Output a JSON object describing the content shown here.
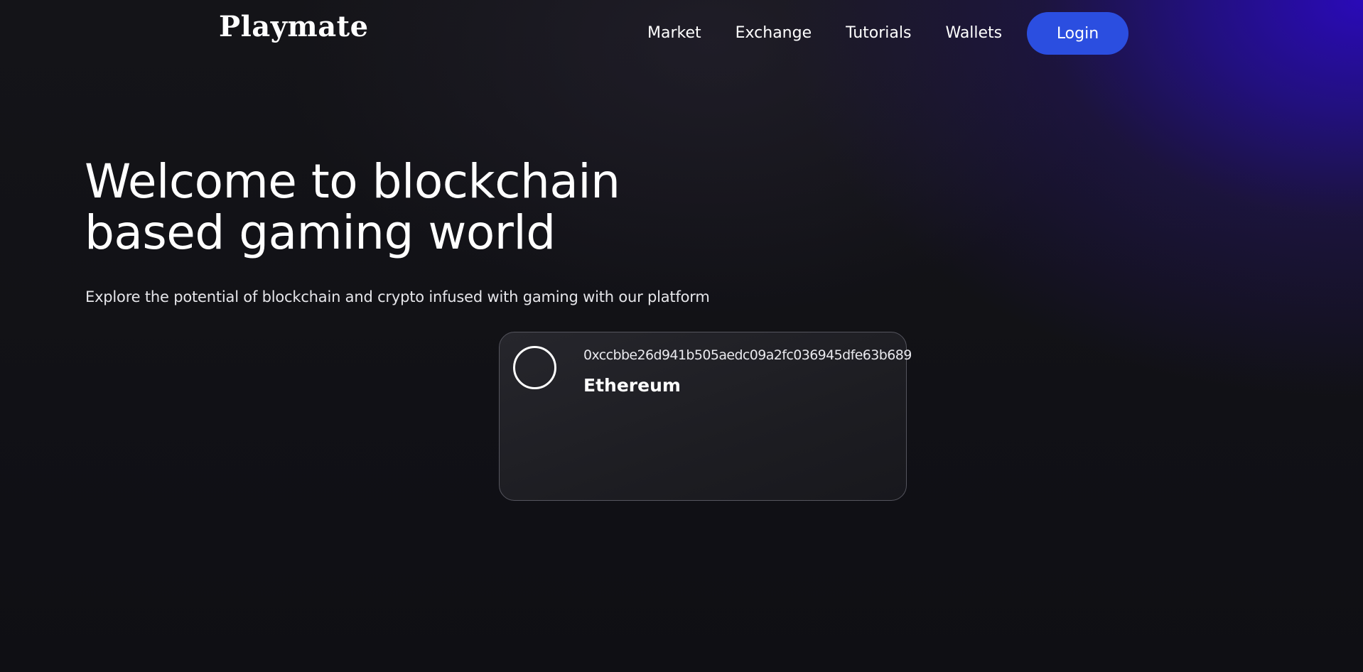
{
  "brand": {
    "name": "Playmate"
  },
  "nav": {
    "items": [
      {
        "label": "Market"
      },
      {
        "label": "Exchange"
      },
      {
        "label": "Tutorials"
      },
      {
        "label": "Wallets"
      }
    ],
    "login_label": "Login"
  },
  "hero": {
    "title": "Welcome to blockchain based gaming world",
    "subtitle": "Explore the potential of blockchain and crypto infused with gaming with our platform"
  },
  "wallet_card": {
    "avatar_icon": "circle-avatar-icon",
    "address": "0xccbbe26d941b505aedc09a2fc036945dfe63b689",
    "chain": "Ethereum"
  },
  "colors": {
    "background": "#111116",
    "accent_glow": "#2a0ab8",
    "login_button": "#2b4ee0",
    "card_border": "#55555e"
  }
}
